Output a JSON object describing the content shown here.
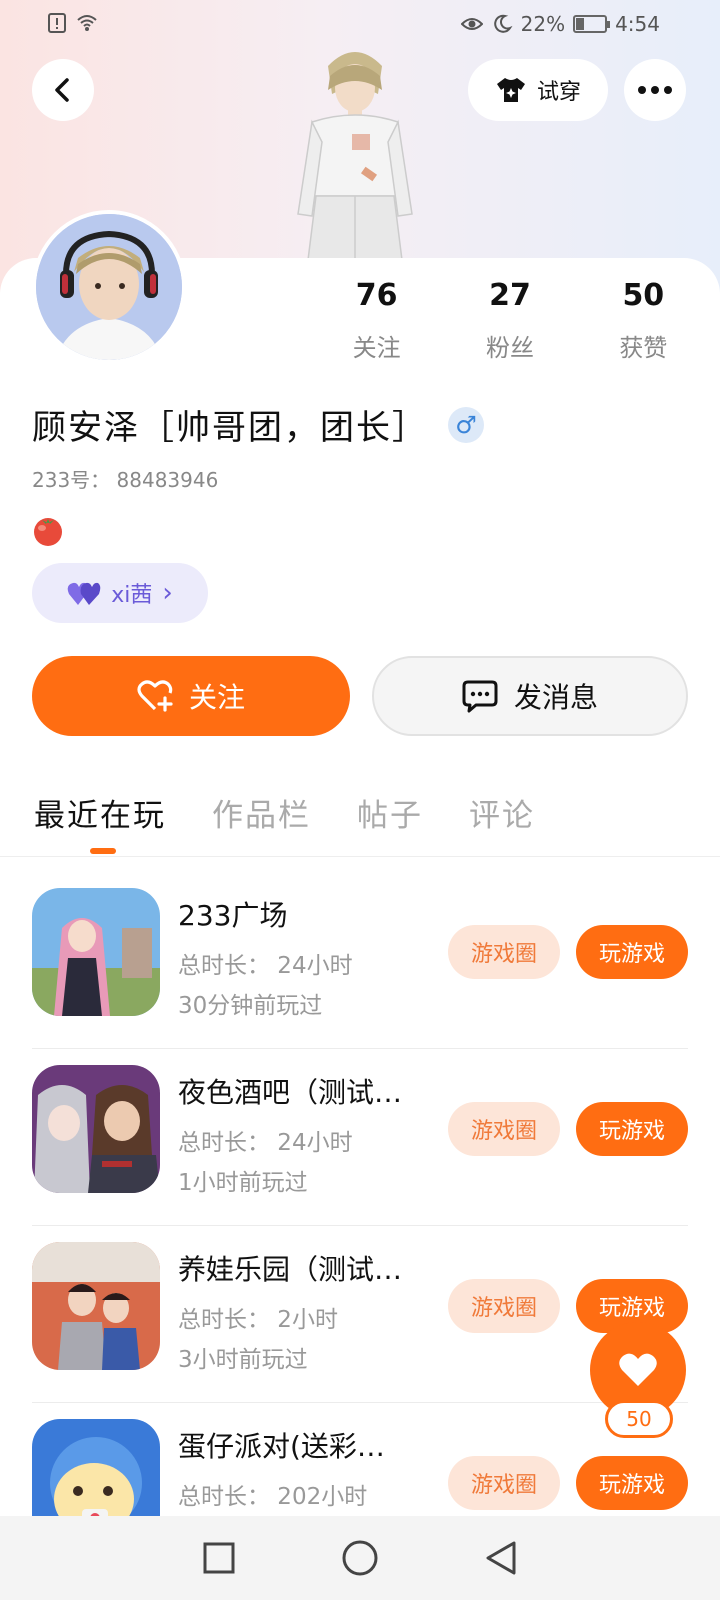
{
  "status_bar": {
    "battery_percent": "22%",
    "time": "4:54"
  },
  "header": {
    "tryon_label": "试穿"
  },
  "profile": {
    "stats": [
      {
        "value": "76",
        "label": "关注"
      },
      {
        "value": "27",
        "label": "粉丝"
      },
      {
        "value": "50",
        "label": "获赞"
      }
    ],
    "name": "顾安泽［帅哥团，团长］",
    "gender_symbol": "♂",
    "id_text": "233号： 88483946",
    "tag_label": "xi茜",
    "tag_chevron": "›"
  },
  "actions": {
    "follow_label": "关注",
    "message_label": "发消息"
  },
  "tabs": [
    "最近在玩",
    "作品栏",
    "帖子",
    "评论"
  ],
  "games": [
    {
      "title": "233广场",
      "duration": "总时长： 24小时",
      "last_played": "30分钟前玩过"
    },
    {
      "title": "夜色酒吧（测试…",
      "duration": "总时长： 24小时",
      "last_played": "1小时前玩过"
    },
    {
      "title": "养娃乐园（测试…",
      "duration": "总时长： 2小时",
      "last_played": "3小时前玩过"
    },
    {
      "title": "蛋仔派对(送彩…",
      "duration": "总时长： 202小时",
      "last_played": ""
    }
  ],
  "game_buttons": {
    "circle_label": "游戏圈",
    "play_label": "玩游戏"
  },
  "like_fab": {
    "count": "50"
  },
  "colors": {
    "accent": "#ff6d12",
    "circle_bg": "#fde5d8",
    "tag_purple": "#6a5ad8"
  }
}
